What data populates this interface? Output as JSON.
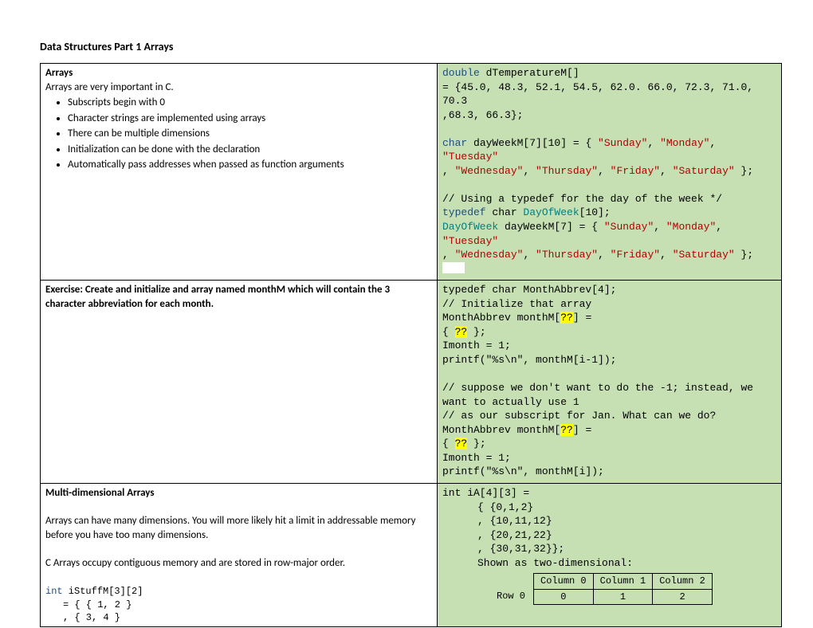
{
  "title": "Data Structures Part 1 Arrays",
  "row1": {
    "left": {
      "heading": "Arrays",
      "intro": "Arrays are very important in C.",
      "b1": "Subscripts begin with 0",
      "b2": "Character strings are implemented using arrays",
      "b3": "There can be multiple dimensions",
      "b4": "Initialization can be done with the declaration",
      "b5": "Automatically pass addresses when passed as function arguments"
    },
    "right": {
      "l1a": "double",
      "l1b": " dTemperatureM[]",
      "l2": "    = {45.0, 48.3, 52.1, 54.5, 62.0. 66.0, 72.3, 71.0, 70.3",
      "l3": "       ,68.3, 66.3};",
      "l4a": "char",
      "l4b": " dayWeekM[7][10] = { ",
      "l4c": "\"Sunday\"",
      "l4d": ", ",
      "l4e": "\"Monday\"",
      "l4f": ", ",
      "l4g": "\"Tuesday\"",
      "l5a": "    , ",
      "l5b": "\"Wednesday\"",
      "l5c": ", ",
      "l5d": "\"Thursday\"",
      "l5e": ", ",
      "l5f": "\"Friday\"",
      "l5g": ", ",
      "l5h": "\"Saturday\"",
      "l5i": " };",
      "l6": "// Using a typedef for the day of the week */",
      "l7a": "typedef",
      "l7b": " char ",
      "l7c": "DayOfWeek",
      "l7d": "[10];",
      "l8a": "DayOfWeek",
      "l8b": " dayWeekM[7] = { ",
      "l8c": "\"Sunday\"",
      "l8d": ", ",
      "l8e": "\"Monday\"",
      "l8f": ", ",
      "l8g": "\"Tuesday\"",
      "l9a": "    , ",
      "l9b": "\"Wednesday\"",
      "l9c": ", ",
      "l9d": "\"Thursday\"",
      "l9e": ", ",
      "l9f": "\"Friday\"",
      "l9g": ", ",
      "l9h": "\"Saturday\"",
      "l9i": " };"
    }
  },
  "row2": {
    "left": {
      "ex": "Exercise:  Create and initialize and array named monthM which will contain the 3 character abbreviation for each month."
    },
    "right": {
      "l1": "typedef char MonthAbbrev[4];",
      "l2": "// Initialize that array",
      "l3a": "MonthAbbrev monthM[",
      "l3hl": "??",
      "l3b": "] =",
      "l4a": "    { ",
      "l4hl": "??",
      "l4b": " };",
      "l5": "Imonth = 1;",
      "l6": "printf(\"%s\\n\", monthM[i-1]);",
      "l7": "// suppose we don't want to do the -1; instead, we want to actually use 1",
      "l8": "// as our subscript for Jan.  What can we do?",
      "l9a": "MonthAbbrev monthM[",
      "l9hl": "??",
      "l9b": "] =",
      "l10a": "    { ",
      "l10hl": "??",
      "l10b": " };",
      "l11": "Imonth = 1;",
      "l12": "printf(\"%s\\n\", monthM[i]);"
    }
  },
  "row3": {
    "left": {
      "h": "Multi-dimensional Arrays",
      "p1": "Arrays can have many dimensions.  You will more likely hit a limit in addressable memory before you have too many dimensions.",
      "p2": "C Arrays occupy contiguous memory and are stored in row-major order.",
      "c1a": "int",
      "c1b": " iStuffM[3][2]",
      "c2": "= { { 1, 2 }",
      "c3": ", { 3, 4 }"
    },
    "right": {
      "l1": "int iA[4][3] =",
      "l2": "{ {0,1,2}",
      "l3": ", {10,11,12}",
      "l4": ", {20,21,22}",
      "l5": ", {30,31,32}};",
      "l6": "Shown as two-dimensional:",
      "th1": "Column 0",
      "th2": "Column 1",
      "th3": "Column 2",
      "trh": "Row 0",
      "td1": "0",
      "td2": "1",
      "td3": "2"
    }
  }
}
